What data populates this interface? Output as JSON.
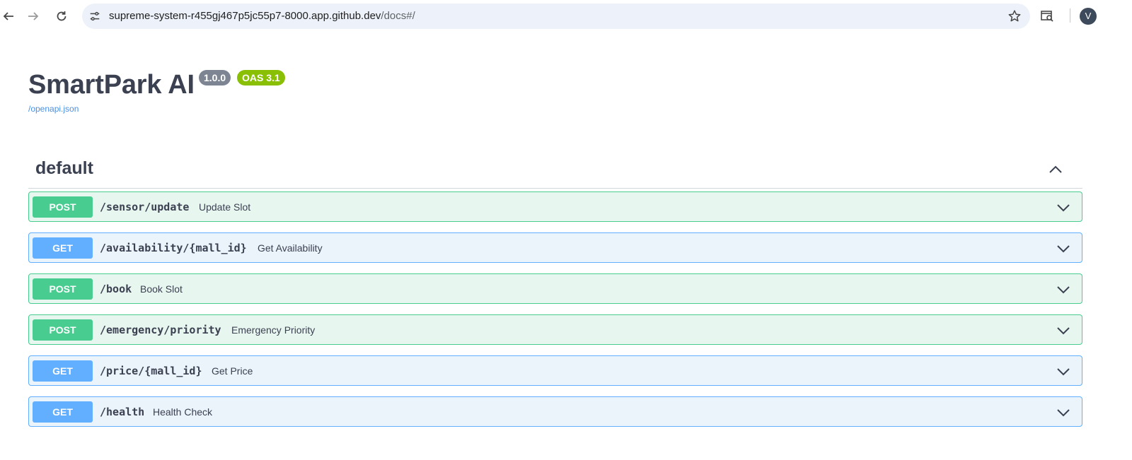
{
  "browser": {
    "url_host": "supreme-system-r455gj467p5jc55p7-8000.app.github.dev",
    "url_path": "/docs#/",
    "profile_initial": "V",
    "icons": [
      "back-arrow-icon",
      "forward-arrow-icon",
      "reload-icon",
      "site-info-icon",
      "bookmark-star-icon",
      "reading-mode-icon",
      "profile-avatar"
    ]
  },
  "api": {
    "title": "SmartPark AI",
    "version": "1.0.0",
    "oas": "OAS 3.1",
    "spec_link": "/openapi.json"
  },
  "section": {
    "name": "default",
    "expanded": true
  },
  "operations": [
    {
      "method": "POST",
      "path": "/sensor/update",
      "summary": "Update Slot"
    },
    {
      "method": "GET",
      "path": "/availability/{mall_id}",
      "summary": "Get Availability"
    },
    {
      "method": "POST",
      "path": "/book",
      "summary": "Book Slot"
    },
    {
      "method": "POST",
      "path": "/emergency/priority",
      "summary": "Emergency Priority"
    },
    {
      "method": "GET",
      "path": "/price/{mall_id}",
      "summary": "Get Price"
    },
    {
      "method": "GET",
      "path": "/health",
      "summary": "Health Check"
    }
  ],
  "colors": {
    "post": "#49cc90",
    "get": "#61affe",
    "version_badge": "#7d8492",
    "oas_badge": "#89bf04",
    "link": "#4990e2"
  }
}
